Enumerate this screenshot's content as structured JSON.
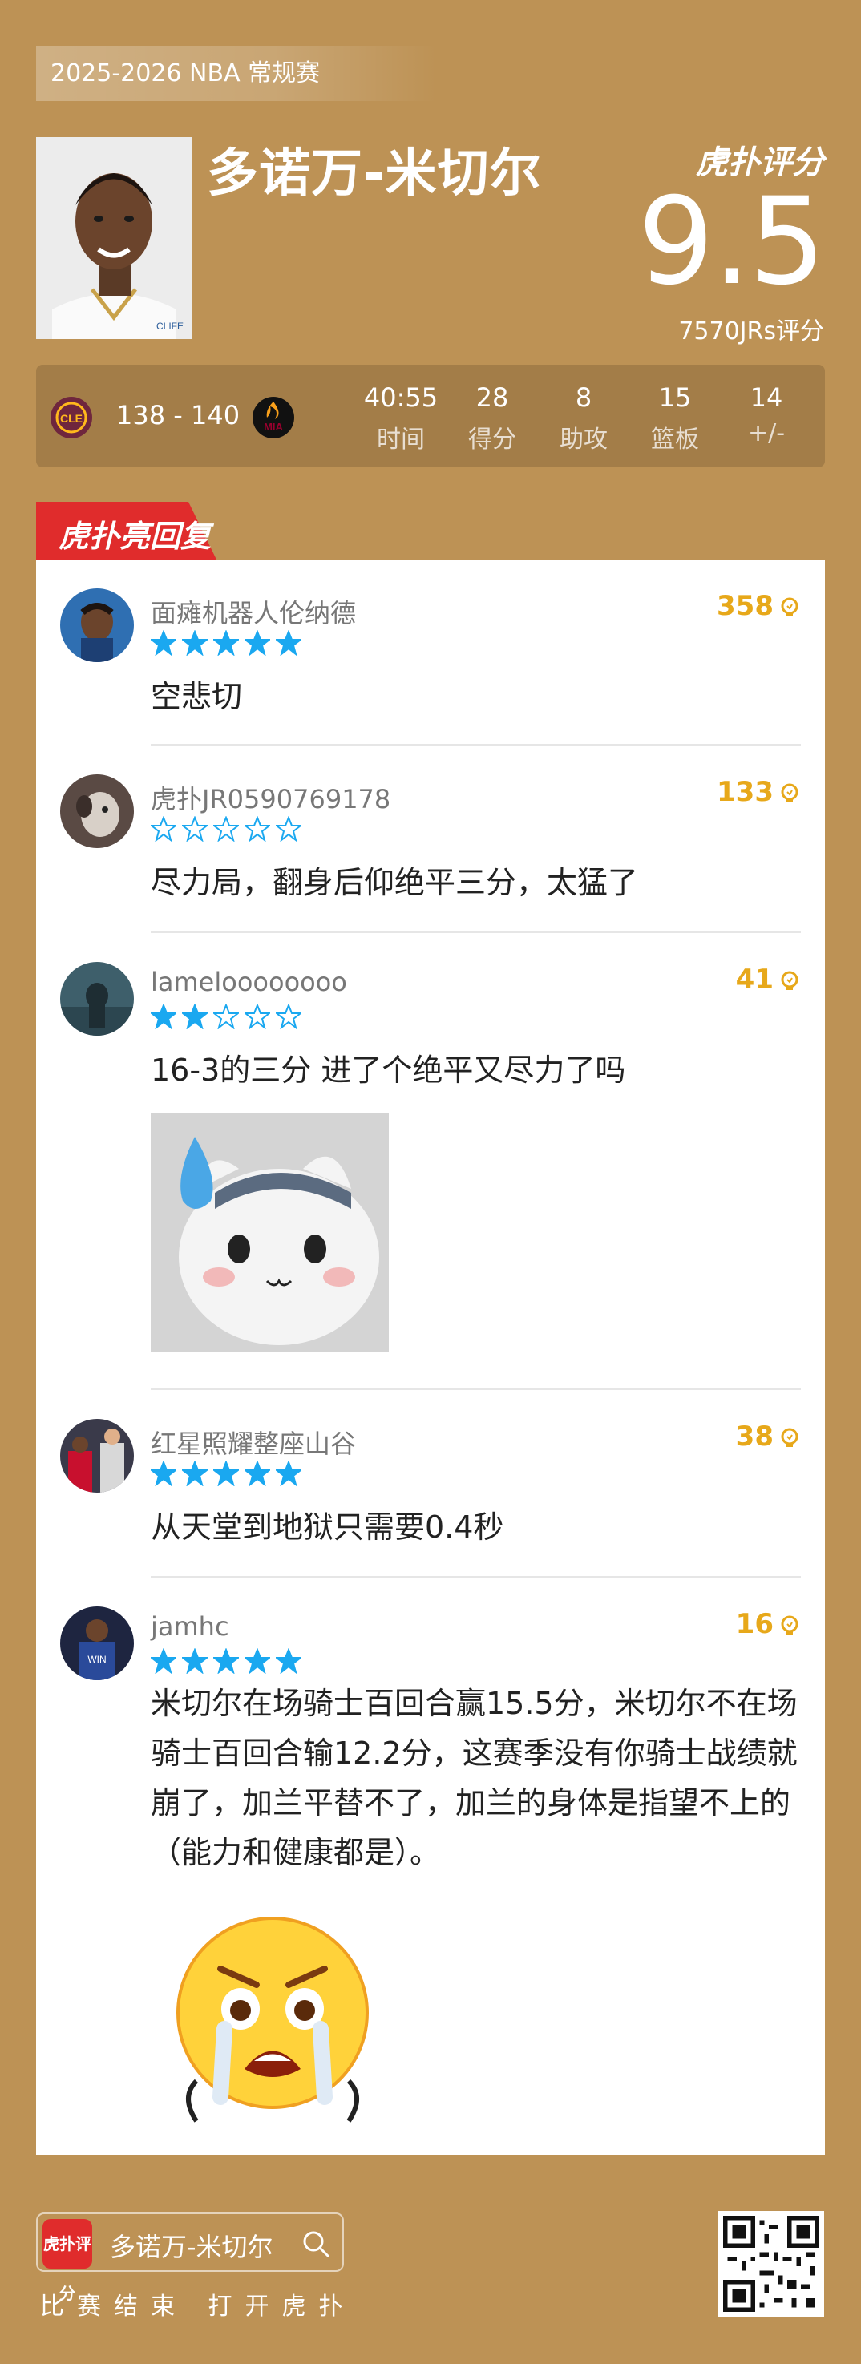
{
  "header": {
    "season": "2025-2026 NBA 常规赛",
    "player_name": "多诺万-米切尔",
    "brand": "虎扑评分",
    "score": "9.5",
    "votes": "7570JRs评分"
  },
  "game": {
    "result": "138 - 140",
    "home_logo": "cavaliers-logo",
    "away_logo": "heat-logo",
    "stats": [
      {
        "value": "40:55",
        "label": "时间"
      },
      {
        "value": "28",
        "label": "得分"
      },
      {
        "value": "8",
        "label": "助攻"
      },
      {
        "value": "15",
        "label": "篮板"
      },
      {
        "value": "14",
        "label": "+/-"
      }
    ]
  },
  "highlights": {
    "tag": "虎扑亮回复",
    "comments": [
      {
        "user": "面瘫机器人伦纳德",
        "likes": "358",
        "stars": 5,
        "text": "空悲切"
      },
      {
        "user": "虎扑JR0590769178",
        "likes": "133",
        "stars": 0,
        "text": "尽力局，翻身后仰绝平三分，太猛了"
      },
      {
        "user": "lameloooooooo",
        "likes": "41",
        "stars": 2,
        "text": "16-3的三分 进了个绝平又尽力了吗"
      },
      {
        "user": "红星照耀整座山谷",
        "likes": "38",
        "stars": 5,
        "text": "从天堂到地狱只需要0.4秒"
      },
      {
        "user": "jamhc",
        "likes": "16",
        "stars": 5,
        "text": "米切尔在场骑士百回合赢15.5分，米切尔不在场骑士百回合输12.2分，这赛季没有你骑士战绩就崩了，加兰平替不了，加兰的身体是指望不上的（能力和健康都是）。"
      }
    ]
  },
  "footer": {
    "search_logo": "虎扑评分",
    "search_text": "多诺万-米切尔",
    "tagline": "比赛结束 打开虎扑"
  },
  "colors": {
    "background": "#bd9255",
    "accent_red": "#e02c2c",
    "star_blue": "#1aa8f0",
    "likes_gold": "#e7a81a"
  }
}
